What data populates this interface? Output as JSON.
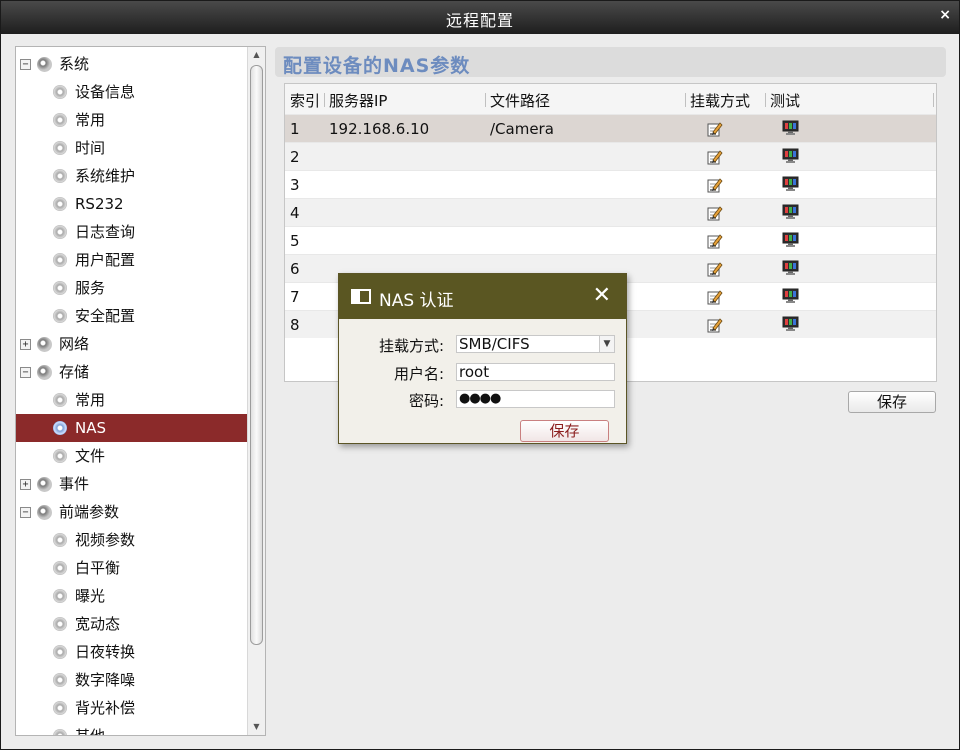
{
  "window": {
    "title": "远程配置",
    "close_glyph": "×"
  },
  "tree": {
    "items": [
      {
        "label": "系统",
        "level": 0,
        "expander": "−"
      },
      {
        "label": "设备信息",
        "level": 1
      },
      {
        "label": "常用",
        "level": 1
      },
      {
        "label": "时间",
        "level": 1
      },
      {
        "label": "系统维护",
        "level": 1
      },
      {
        "label": "RS232",
        "level": 1
      },
      {
        "label": "日志查询",
        "level": 1
      },
      {
        "label": "用户配置",
        "level": 1
      },
      {
        "label": "服务",
        "level": 1
      },
      {
        "label": "安全配置",
        "level": 1
      },
      {
        "label": "网络",
        "level": 0,
        "expander": "+"
      },
      {
        "label": "存储",
        "level": 0,
        "expander": "−"
      },
      {
        "label": "常用",
        "level": 1
      },
      {
        "label": "NAS",
        "level": 1,
        "selected": true
      },
      {
        "label": "文件",
        "level": 1
      },
      {
        "label": "事件",
        "level": 0,
        "expander": "+"
      },
      {
        "label": "前端参数",
        "level": 0,
        "expander": "−"
      },
      {
        "label": "视频参数",
        "level": 1
      },
      {
        "label": "白平衡",
        "level": 1
      },
      {
        "label": "曝光",
        "level": 1
      },
      {
        "label": "宽动态",
        "level": 1
      },
      {
        "label": "日夜转换",
        "level": 1
      },
      {
        "label": "数字降噪",
        "level": 1
      },
      {
        "label": "背光补偿",
        "level": 1
      },
      {
        "label": "其他",
        "level": 1
      }
    ],
    "scroll_up_glyph": "▲",
    "scroll_down_glyph": "▼"
  },
  "main": {
    "section_title": "配置设备的NAS参数",
    "table": {
      "headers": [
        "索引",
        "服务器IP",
        "文件路径",
        "挂载方式",
        "测试"
      ],
      "rows": [
        {
          "index": "1",
          "ip": "192.168.6.10",
          "path": "/Camera"
        },
        {
          "index": "2",
          "ip": "",
          "path": ""
        },
        {
          "index": "3",
          "ip": "",
          "path": ""
        },
        {
          "index": "4",
          "ip": "",
          "path": ""
        },
        {
          "index": "5",
          "ip": "",
          "path": ""
        },
        {
          "index": "6",
          "ip": "",
          "path": ""
        },
        {
          "index": "7",
          "ip": "",
          "path": ""
        },
        {
          "index": "8",
          "ip": "",
          "path": ""
        }
      ],
      "edit_icon": "edit-pencil-icon",
      "test_icon": "monitor-test-icon"
    },
    "save_label": "保存"
  },
  "dialog": {
    "title": "NAS 认证",
    "close_glyph": "✕",
    "mount_label": "挂载方式:",
    "mount_value": "SMB/CIFS",
    "mount_arrow": "▼",
    "username_label": "用户名:",
    "username_value": "root",
    "password_label": "密码:",
    "password_value": "●●●●",
    "save_label": "保存"
  },
  "colors": {
    "selected_tree_bg": "#8b2a2a",
    "dialog_titlebar": "#5a5622",
    "section_title": "#6d8cbf"
  }
}
